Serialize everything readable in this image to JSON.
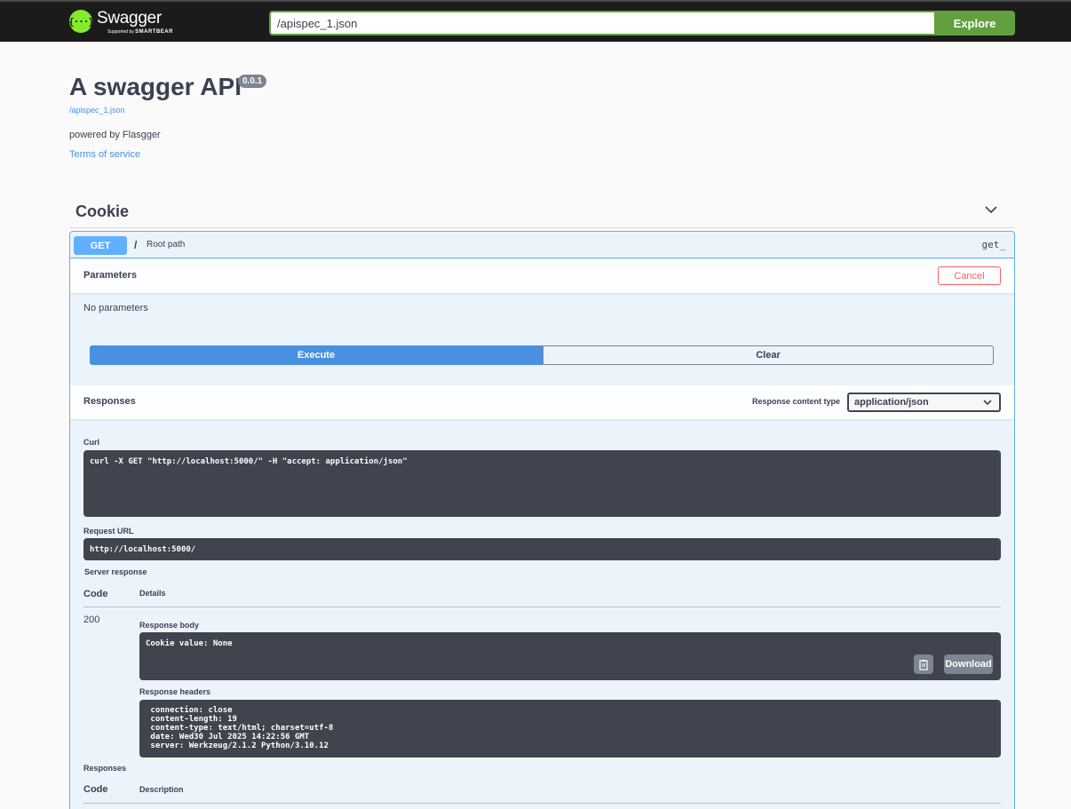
{
  "topbar": {
    "logo_name": "Swagger",
    "logo_supported": "Supported by",
    "logo_brand": "SMARTBEAR",
    "url_value": "/apispec_1.json",
    "explore_label": "Explore"
  },
  "info": {
    "title": "A swagger API",
    "version": "0.0.1",
    "spec_url": "/apispec_1.json",
    "description": "powered by Flasgger",
    "terms": "Terms of service"
  },
  "tag": {
    "name": "Cookie",
    "expanded": true
  },
  "operation": {
    "method": "GET",
    "path": "/",
    "summary": "Root path",
    "operation_id": "get_",
    "parameters_title": "Parameters",
    "cancel_label": "Cancel",
    "no_parameters": "No parameters",
    "execute_label": "Execute",
    "clear_label": "Clear",
    "responses_title": "Responses",
    "response_content_type_label": "Response content type",
    "response_content_type": "application/json"
  },
  "result": {
    "curl_label": "Curl",
    "curl": "curl -X GET \"http://localhost:5000/\" -H \"accept: application/json\"",
    "request_url_label": "Request URL",
    "request_url": "http://localhost:5000/",
    "server_response_label": "Server response",
    "code_header": "Code",
    "details_header": "Details",
    "status_code": "200",
    "response_body_label": "Response body",
    "response_body": "Cookie value: None",
    "download_label": "Download",
    "response_headers_label": "Response headers",
    "response_headers": " connection: close \n content-length: 19 \n content-type: text/html; charset=utf-8 \n date: Wed30 Jul 2025 14:22:56 GMT \n server: Werkzeug/2.1.2 Python/3.10.12 "
  },
  "responses_table": {
    "title": "Responses",
    "code_header": "Code",
    "description_header": "Description"
  },
  "colors": {
    "topbar": "#1b1b1b",
    "accent_green": "#62a03f",
    "get_blue": "#61affe",
    "execute_blue": "#4990e2",
    "cancel_red": "#ff6060",
    "code_bg": "#41444e"
  }
}
